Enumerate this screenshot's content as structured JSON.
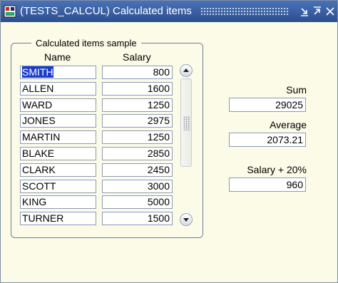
{
  "window": {
    "title": "(TESTS_CALCUL)  Calculated items",
    "minimize_icon": "minimize-icon",
    "maximize_icon": "maximize-icon",
    "accent": "#3a5fa0",
    "background": "#fbfbe7"
  },
  "frame": {
    "title": "Calculated items sample",
    "name_header": "Name",
    "salary_header": "Salary"
  },
  "rows": [
    {
      "name": "SMITH",
      "salary": "800"
    },
    {
      "name": "ALLEN",
      "salary": "1600"
    },
    {
      "name": "WARD",
      "salary": "1250"
    },
    {
      "name": "JONES",
      "salary": "2975"
    },
    {
      "name": "MARTIN",
      "salary": "1250"
    },
    {
      "name": "BLAKE",
      "salary": "2850"
    },
    {
      "name": "CLARK",
      "salary": "2450"
    },
    {
      "name": "SCOTT",
      "salary": "3000"
    },
    {
      "name": "KING",
      "salary": "5000"
    },
    {
      "name": "TURNER",
      "salary": "1500"
    }
  ],
  "summary": {
    "sum_label": "Sum",
    "sum_value": "29025",
    "avg_label": "Average",
    "avg_value": "2073.21",
    "salary_plus_label": "Salary + 20%",
    "salary_plus_value": "960"
  },
  "selection_color": "#1a3cc8"
}
